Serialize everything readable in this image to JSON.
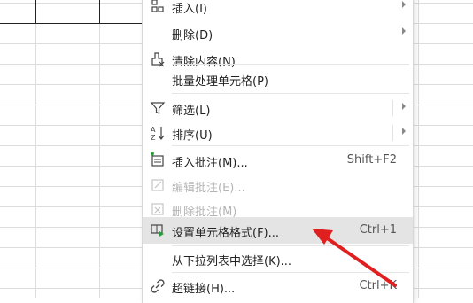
{
  "menu": {
    "items": [
      {
        "label": "插入(I)",
        "shortcut": "",
        "icon": "insert-cells-icon",
        "submenu": true,
        "disabled": false
      },
      {
        "label": "删除(D)",
        "shortcut": "",
        "icon": "",
        "submenu": true,
        "disabled": false
      },
      {
        "label": "清除内容(N)",
        "shortcut": "",
        "icon": "eraser-icon",
        "submenu": false,
        "disabled": false
      },
      {
        "label": "批量处理单元格(P)",
        "shortcut": "",
        "icon": "",
        "submenu": false,
        "disabled": false
      },
      {
        "label": "筛选(L)",
        "shortcut": "",
        "icon": "filter-icon",
        "submenu": true,
        "disabled": false
      },
      {
        "label": "排序(U)",
        "shortcut": "",
        "icon": "sort-az-icon",
        "submenu": true,
        "disabled": false
      },
      {
        "label": "插入批注(M)...",
        "shortcut": "Shift+F2",
        "icon": "insert-comment-icon",
        "submenu": false,
        "disabled": false
      },
      {
        "label": "编辑批注(E)...",
        "shortcut": "",
        "icon": "edit-comment-icon",
        "submenu": false,
        "disabled": true
      },
      {
        "label": "删除批注(M)",
        "shortcut": "",
        "icon": "delete-comment-icon",
        "submenu": false,
        "disabled": true
      },
      {
        "label": "设置单元格格式(F)...",
        "shortcut": "Ctrl+1",
        "icon": "format-cells-icon",
        "submenu": false,
        "disabled": false,
        "highlighted": true
      },
      {
        "label": "从下拉列表中选择(K)...",
        "shortcut": "",
        "icon": "",
        "submenu": false,
        "disabled": false
      },
      {
        "label": "超链接(H)...",
        "shortcut": "Ctrl+K",
        "icon": "link-icon",
        "submenu": false,
        "disabled": false
      }
    ]
  },
  "colors": {
    "highlight": "#e4e4e4",
    "annotation_arrow": "#e02020",
    "disabled_text": "#b5b5b5"
  }
}
